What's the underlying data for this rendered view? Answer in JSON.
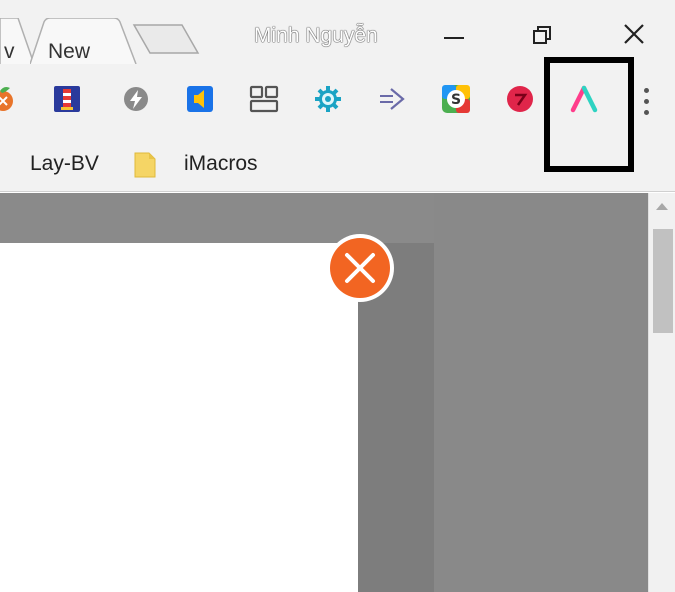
{
  "titlebar": {
    "partial_tab_label": "v",
    "active_tab_label": "New",
    "profile_name": "Minh Nguyễn"
  },
  "toolbar": {
    "extensions": [
      {
        "name": "orange-leaf-extension-icon",
        "color": "#e8742a"
      },
      {
        "name": "lighthouse-extension-icon",
        "color": "#2a3a9c"
      },
      {
        "name": "lightning-extension-icon",
        "color": "#8a8a8a"
      },
      {
        "name": "speaker-extension-icon",
        "color": "#1a73e8"
      },
      {
        "name": "grid-layout-extension-icon",
        "color": "#555555"
      },
      {
        "name": "gear-extension-icon",
        "color": "#1aa3c4"
      },
      {
        "name": "arrow-extension-icon",
        "color": "#6a6aa8"
      },
      {
        "name": "s-extension-icon",
        "color": "#e53935"
      },
      {
        "name": "red-circle-extension-icon",
        "color": "#e0254a"
      },
      {
        "name": "lambda-extension-icon",
        "color": "#ff3d8b"
      }
    ],
    "highlight_color": "#000000"
  },
  "bookmarks": {
    "items": [
      {
        "label": "Lay-BV"
      },
      {
        "label": "iMacros"
      }
    ],
    "folder_color": "#f5d565"
  },
  "content": {
    "popup_close_color": "#f26522",
    "overlay_color": "#7d7d7d"
  }
}
